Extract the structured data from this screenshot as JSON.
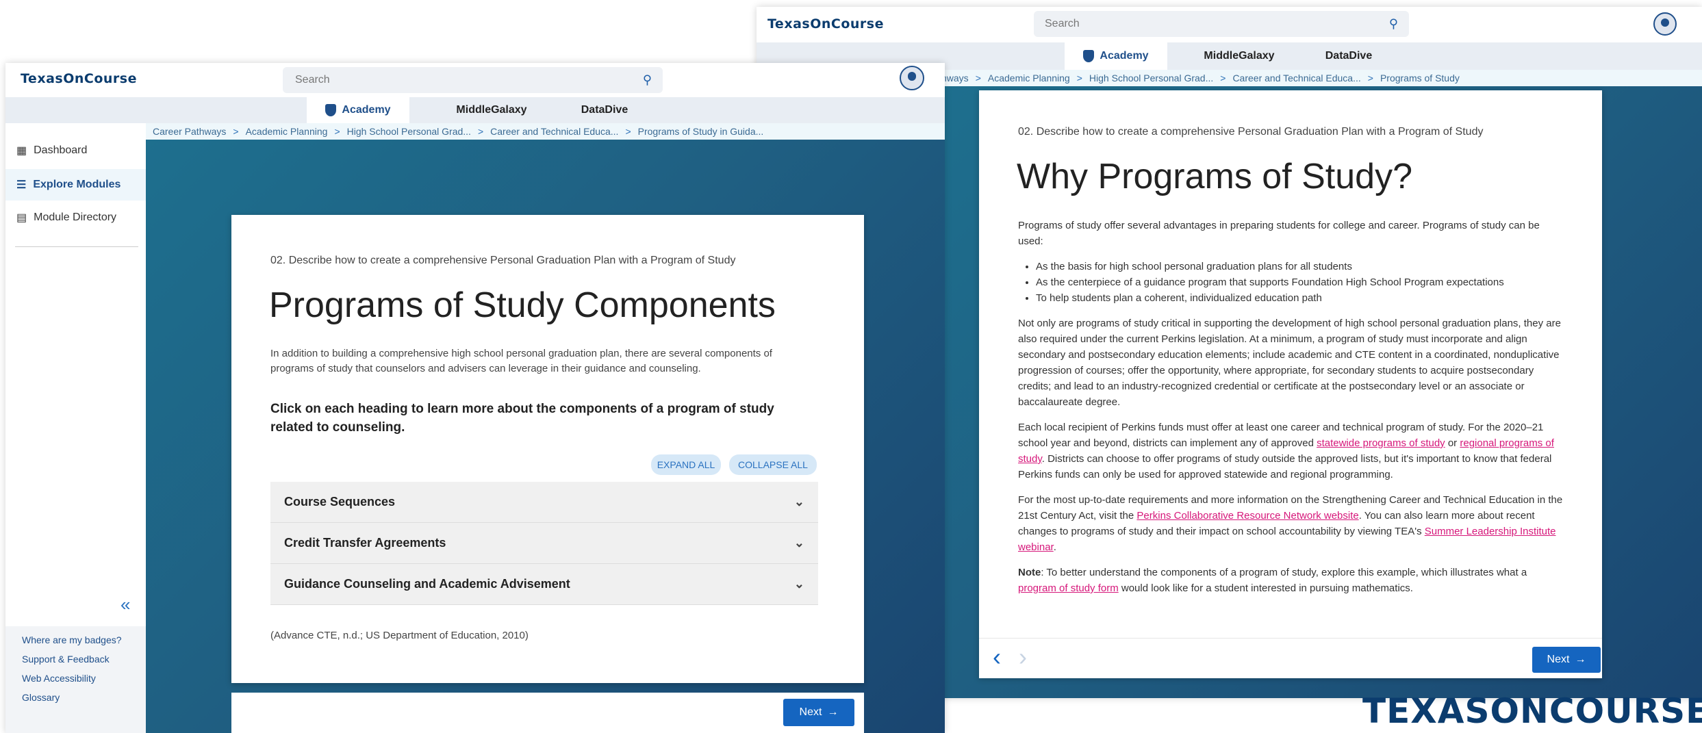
{
  "left_window": {
    "logo": "TexasOnCourse",
    "search_placeholder": "Search",
    "nav_tabs": [
      "Academy",
      "MiddleGalaxy",
      "DataDive"
    ],
    "breadcrumb": [
      "Career Pathways",
      "Academic Planning",
      "High School Personal Grad...",
      "Career and Technical Educa...",
      "Programs of Study in Guida..."
    ],
    "sidebar": {
      "items": [
        {
          "label": "Dashboard",
          "icon": "dashboard-icon"
        },
        {
          "label": "Explore Modules",
          "icon": "list-icon"
        },
        {
          "label": "Module Directory",
          "icon": "directory-icon"
        }
      ],
      "collapse": "«",
      "links": [
        "Where are my badges?",
        "Support & Feedback",
        "Web Accessibility",
        "Glossary"
      ]
    },
    "card": {
      "objective": "02. Describe how to create a comprehensive Personal Graduation Plan with a Program of Study",
      "title": "Programs of Study Components",
      "intro": "In addition to building a comprehensive high school personal graduation plan, there are several components of programs of study that counselors and advisers can leverage in their guidance and counseling.",
      "instruction": "Click on each heading to learn more about the components of a program of study related to counseling.",
      "expand_all": "EXPAND ALL",
      "collapse_all": "COLLAPSE ALL",
      "accordion": [
        "Course Sequences",
        "Credit Transfer Agreements",
        "Guidance Counseling and Academic Advisement"
      ],
      "citation": "(Advance CTE, n.d.; US Department of Education, 2010)"
    },
    "next_label": "Next"
  },
  "right_window": {
    "logo": "TexasOnCourse",
    "search_placeholder": "Search",
    "nav_tabs": [
      "Academy",
      "MiddleGalaxy",
      "DataDive"
    ],
    "breadcrumb": [
      "hways",
      "Academic Planning",
      "High School Personal Grad...",
      "Career and Technical Educa...",
      "Programs of Study"
    ],
    "objective": "02. Describe how to create a comprehensive Personal Graduation Plan with a Program of Study",
    "title": "Why Programs of Study?",
    "p1": "Programs of study offer several advantages in preparing students for college and career. Programs of study can be used:",
    "bullets": [
      "As the basis for high school personal graduation plans for all students",
      "As the centerpiece of a guidance program that supports Foundation High School Program expectations",
      "To help students plan a coherent, individualized education path"
    ],
    "p2": "Not only are programs of study critical in supporting the development of high school personal graduation plans, they are also required under the current Perkins legislation. At a minimum, a program of study must incorporate and align secondary and postsecondary education elements; include academic and CTE content in a coordinated, nonduplicative progression of courses; offer the opportunity, where appropriate, for secondary students to acquire postsecondary credits; and lead to an industry-recognized credential or certificate at the postsecondary level or an associate or baccalaureate degree.",
    "p3": {
      "a": "Each local recipient of Perkins funds must offer at least one career and technical program of study. For the 2020–21 school year and beyond, districts can implement any of approved ",
      "link1": "statewide programs of study",
      "b": " or ",
      "link2": "regional programs of study",
      "c": ". Districts can choose to offer programs of study outside the approved lists, but it's important to know that federal Perkins funds can only be used for approved statewide and regional programming."
    },
    "p4": {
      "a": "For the most up-to-date requirements and more information on the Strengthening Career and Technical Education in the 21st Century Act, visit the ",
      "link1": "Perkins Collaborative Resource Network website",
      "b": ". You can also learn more about recent changes to programs of study and their impact on school accountability by viewing TEA's ",
      "link2": "Summer Leadership Institute webinar",
      "c": "."
    },
    "note": {
      "label": "Note",
      "a": ": To better understand the components of a program of study, explore this example, which illustrates what a ",
      "link": "program of study form",
      "b": " would look like for a student interested in pursuing mathematics."
    },
    "prev_symbol": "‹",
    "fwd_symbol": "›",
    "next_label": "Next"
  },
  "brand_logo": "TexasOnCourse",
  "colors": {
    "brand_navy": "#0b3c6e",
    "accent_blue": "#1565c0",
    "link_pink": "#d6177a",
    "hero_teal": "#1e6f8e"
  }
}
